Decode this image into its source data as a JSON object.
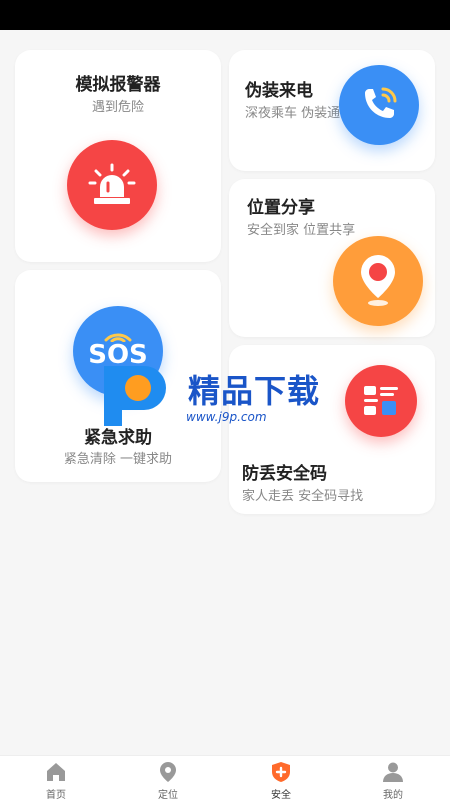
{
  "cards": {
    "alarm": {
      "title": "模拟报警器",
      "subtitle": "遇到危险"
    },
    "fake_call": {
      "title": "伪装来电",
      "subtitle": "深夜乘车  伪装通"
    },
    "location_share": {
      "title": "位置分享",
      "subtitle": "安全到家  位置共享"
    },
    "sos": {
      "title": "紧急求助",
      "subtitle": "紧急清除  一键求助",
      "icon_text": "SOS"
    },
    "anti_lost": {
      "title": "防丢安全码",
      "subtitle": "家人走丢  安全码寻找"
    }
  },
  "watermark": {
    "text": "精品下载",
    "url": "www.j9p.com"
  },
  "nav": {
    "items": [
      {
        "label": "首页",
        "icon": "home-icon"
      },
      {
        "label": "定位",
        "icon": "location-icon"
      },
      {
        "label": "安全",
        "icon": "shield-plus-icon"
      },
      {
        "label": "我的",
        "icon": "person-icon"
      }
    ],
    "active_index": 2
  },
  "colors": {
    "red": "#f54545",
    "blue": "#3a8ff5",
    "orange": "#ff9d3a",
    "active_nav": "#ff6a2b"
  }
}
